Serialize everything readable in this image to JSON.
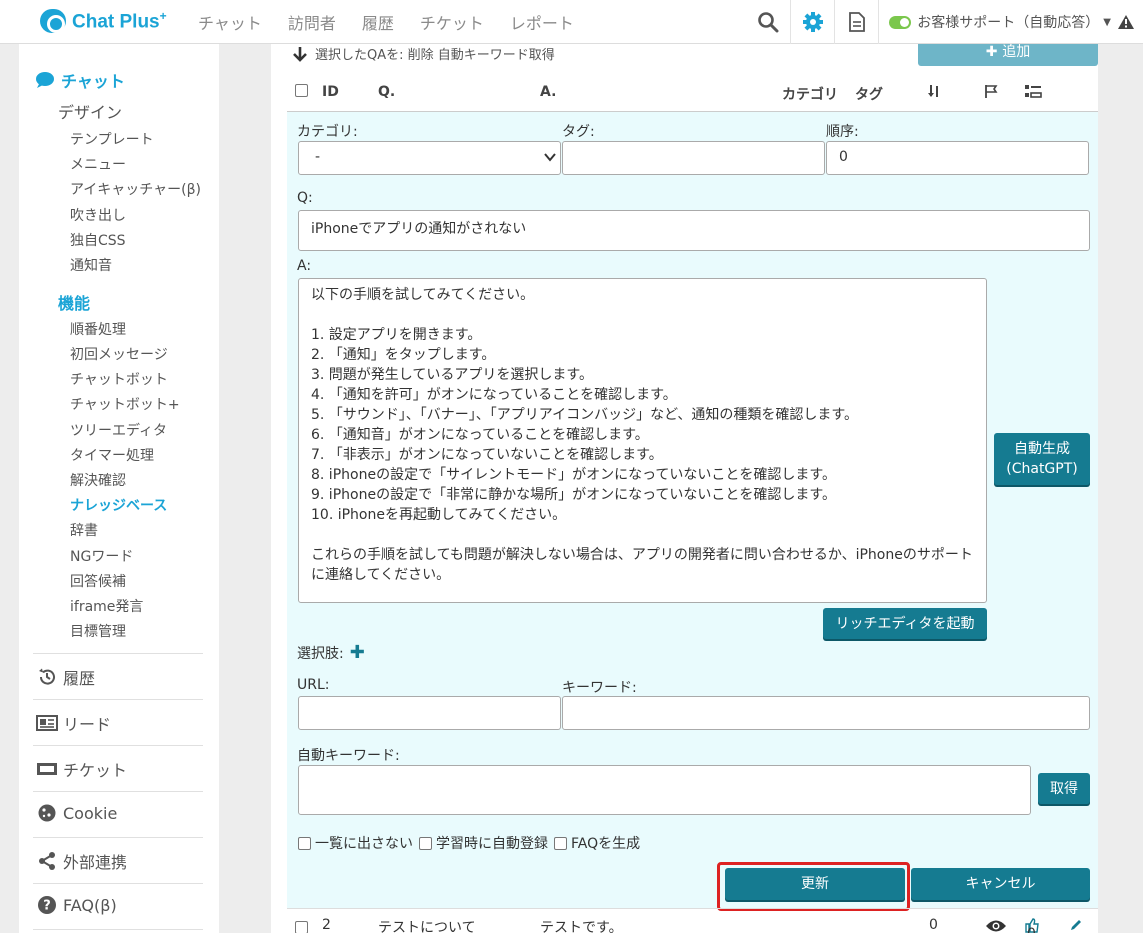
{
  "topbar": {
    "logo": "Chat Plus",
    "logo_sup": "+",
    "nav": [
      "チャット",
      "訪問者",
      "履歴",
      "チケット",
      "レポート"
    ],
    "status_text": "お客様サポート（自動応答）"
  },
  "sidebar": {
    "chat": "チャット",
    "design": "デザイン",
    "design_items": [
      "テンプレート",
      "メニュー",
      "アイキャッチャー(β)",
      "吹き出し",
      "独自CSS",
      "通知音"
    ],
    "feature_head": "機能",
    "feature_items": [
      "順番処理",
      "初回メッセージ",
      "チャットボット",
      "チャットボット+",
      "ツリーエディタ",
      "タイマー処理",
      "解決確認",
      "ナレッジベース",
      "辞書",
      "NGワード",
      "回答候補",
      "iframe発言",
      "目標管理"
    ],
    "main_items": [
      "履歴",
      "リード",
      "チケット",
      "Cookie",
      "外部連携",
      "FAQ(β)"
    ],
    "active_item": "ナレッジベース"
  },
  "main": {
    "select_bar": "選択したQAを: 削除 自動キーワード取得",
    "add_label": "追加",
    "columns": [
      "ID",
      "Q.",
      "A.",
      "カテゴリ",
      "タグ"
    ],
    "form": {
      "category_label": "カテゴリ:",
      "category_value": "-",
      "tag_label": "タグ:",
      "tag_value": "",
      "order_label": "順序:",
      "order_value": "0",
      "q_label": "Q:",
      "q_value": "iPhoneでアプリの通知がされない",
      "a_label": "A:",
      "a_value": "以下の手順を試してみてください。\n\n1. 設定アプリを開きます。\n2. 「通知」をタップします。\n3. 問題が発生しているアプリを選択します。\n4. 「通知を許可」がオンになっていることを確認します。\n5. 「サウンド」、「バナー」、「アプリアイコンバッジ」など、通知の種類を確認します。\n6. 「通知音」がオンになっていることを確認します。\n7. 「非表示」がオンになっていないことを確認します。\n8. iPhoneの設定で「サイレントモード」がオンになっていないことを確認します。\n9. iPhoneの設定で「非常に静かな場所」がオンになっていないことを確認します。\n10. iPhoneを再起動してみてください。\n\nこれらの手順を試しても問題が解決しない場合は、アプリの開発者に問い合わせるか、iPhoneのサポートに連絡してください。",
      "auto_gen_line1": "自動生成",
      "auto_gen_line2": "(ChatGPT)",
      "rich_editor": "リッチエディタを起動",
      "choices_label": "選択肢:",
      "url_label": "URL:",
      "url_value": "",
      "keyword_label": "キーワード:",
      "keyword_value": "",
      "auto_keyword_label": "自動キーワード:",
      "auto_keyword_value": "",
      "fetch": "取得",
      "chk_hide": "一覧に出さない",
      "chk_learn": "学習時に自動登録",
      "chk_faq": "FAQを生成",
      "update": "更新",
      "cancel": "キャンセル"
    },
    "row": {
      "id": "2",
      "q": "テストについて",
      "a": "テストです。",
      "order": "0",
      "likes": "0"
    }
  }
}
